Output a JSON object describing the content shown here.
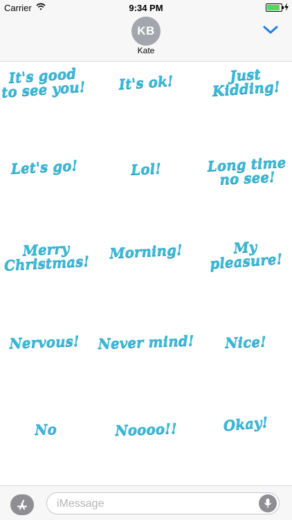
{
  "status_bar": {
    "carrier": "Carrier",
    "time": "9:34 PM"
  },
  "header": {
    "avatar_initials": "KB",
    "contact_name": "Kate"
  },
  "stickers": [
    "It's good\nto see you!",
    "It's ok!",
    "Just\nKidding!",
    "Let's go!",
    "Lol!",
    "Long time\nno see!",
    "Merry\nChristmas!",
    "Morning!",
    "My\npleasure!",
    "Nervous!",
    "Never mind!",
    "Nice!",
    "No",
    "Noooo!!",
    "Okay!"
  ],
  "input": {
    "placeholder": "iMessage"
  },
  "colors": {
    "accent": "#1f7fe0",
    "sticker": "#3bb8d6",
    "battery": "#4cd964"
  },
  "icons": [
    "wifi-icon",
    "battery-icon",
    "charging-bolt-icon",
    "chevron-down-icon",
    "app-store-icon",
    "microphone-icon"
  ]
}
